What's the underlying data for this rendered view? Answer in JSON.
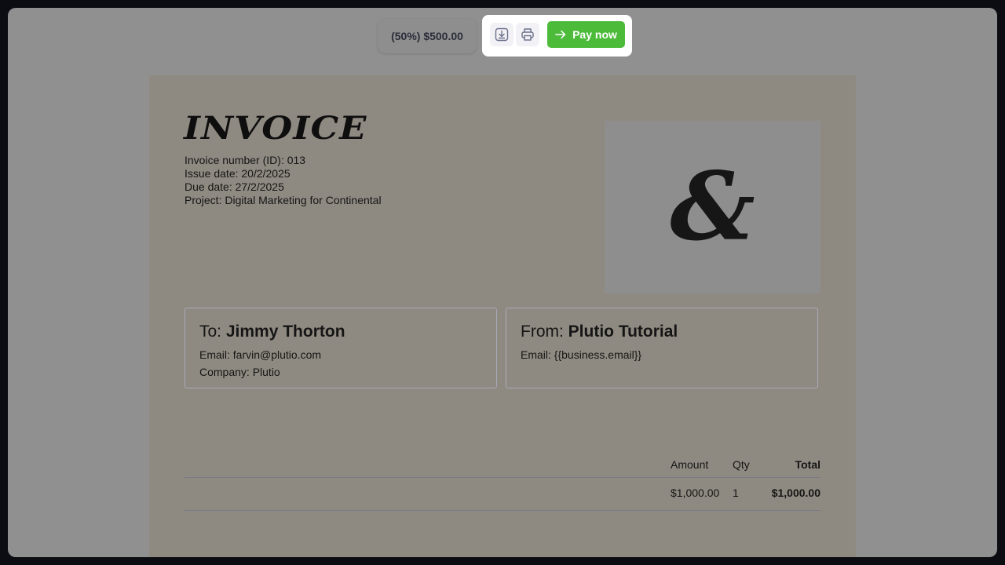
{
  "toolbar": {
    "amount_label": "(50%) $500.00",
    "pay_label": "Pay now",
    "download_icon": "download-icon",
    "print_icon": "printer-icon",
    "pay_icon": "arrow-right-icon",
    "pay_color": "#4cbb3a"
  },
  "invoice": {
    "title": "INVOICE",
    "number": "Invoice number (ID): 013",
    "issue_date": "Issue date: 20/2/2025",
    "due_date": "Due date: 27/2/2025",
    "project": "Project: Digital Marketing for Continental",
    "logo_glyph": "&"
  },
  "to": {
    "prefix": "To: ",
    "name": "Jimmy Thorton",
    "email": "Email: farvin@plutio.com",
    "company": "Company: Plutio"
  },
  "from": {
    "prefix": "From: ",
    "name": "Plutio Tutorial",
    "email": "Email: {{business.email}}"
  },
  "items_table": {
    "headers": {
      "amount": "Amount",
      "qty": "Qty",
      "total": "Total"
    },
    "rows": [
      {
        "amount": "$1,000.00",
        "qty": "1",
        "total": "$1,000.00"
      }
    ]
  }
}
